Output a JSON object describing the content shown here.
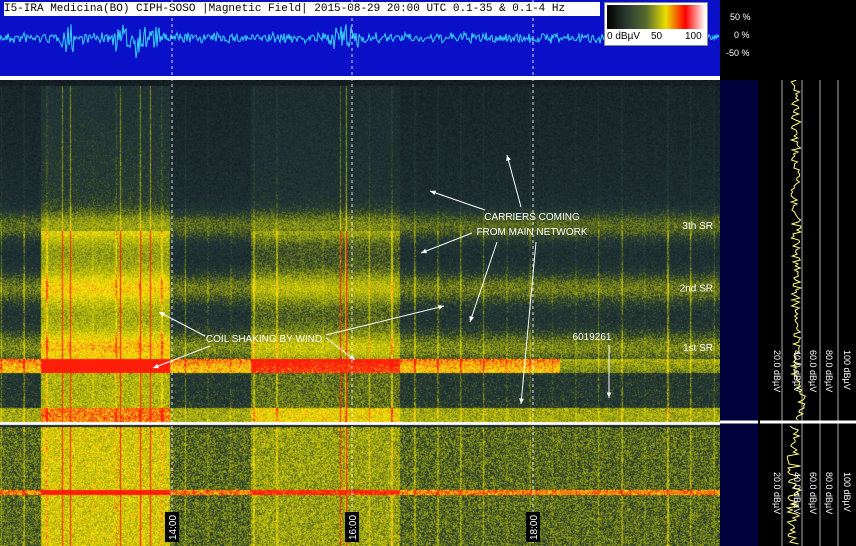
{
  "header": {
    "title": "I5-IRA Medicina(BO) CIPH-SOSO |Magnetic Field| 2015-08-29 20:00 UTC 0.1-35 & 0.1-4 Hz"
  },
  "colorbar": {
    "labels": [
      "0 dBµV",
      "50",
      "100"
    ],
    "colors": [
      "#000000",
      "#2a3a30",
      "#556b2f",
      "#e8e000",
      "#ff0000",
      "#ffffff"
    ]
  },
  "waveform_scale": [
    "50 %",
    "0 %",
    "-50 %"
  ],
  "side_plot": {
    "labels": [
      "20.0 dBµV",
      "40.0 dBµV",
      "60.0 dBµV",
      "80.0 dBµV",
      "100 dBµV"
    ]
  },
  "chart_data": [
    {
      "type": "heatmap",
      "title": "I5-IRA Medicina(BO) CIPH-SOSO |Magnetic Field| 2015-08-29 20:00 UTC 0.1-35 & 0.1-4 Hz",
      "xlabel": "",
      "ylabel": "",
      "x_ticks": [
        "14:00",
        "16:00",
        "18:00"
      ],
      "upper_panel": {
        "ylim": [
          0,
          35
        ],
        "y_ticks": [
          2,
          4,
          6,
          8,
          10,
          12,
          14,
          16,
          18,
          20,
          22,
          24,
          26,
          28,
          30,
          32,
          34
        ],
        "y_unit_label": "Hz",
        "band_labels": [
          {
            "text": "1st SR",
            "freq": 7.8
          },
          {
            "text": "2nd SR",
            "freq": 14
          },
          {
            "text": "3th SR",
            "freq": 20.5
          }
        ]
      },
      "lower_panel": {
        "ylim": [
          0,
          4
        ],
        "y_ticks": [
          1,
          2,
          3
        ],
        "y_unit_label": "Hz"
      },
      "annotations": [
        {
          "text": "CARRIERS COMING\nFROM MAIN NETWORK"
        },
        {
          "text": "COIL SHAKING BY WIND"
        },
        {
          "text": "6019261"
        }
      ],
      "grid": true
    }
  ]
}
